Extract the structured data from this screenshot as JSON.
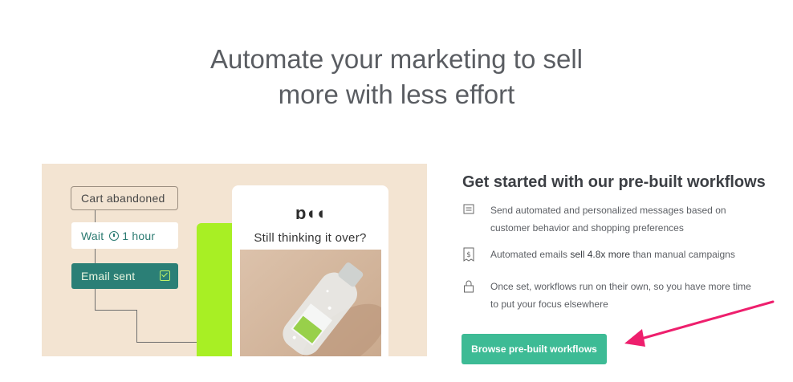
{
  "hero": {
    "line1": "Automate your marketing to sell",
    "line2": "more with less effort"
  },
  "illustration": {
    "cart_chip": "Cart abandoned",
    "wait_label": "Wait",
    "wait_value": "1 hour",
    "email_chip": "Email sent",
    "card_logo": "ɒ◖◖",
    "card_title": "Still thinking it over?"
  },
  "workflows": {
    "title": "Get started with our pre-built workflows",
    "features": [
      {
        "icon": "document-icon",
        "text": "Send automated and personalized messages based on customer behavior and shopping preferences"
      },
      {
        "icon": "dollar-receipt-icon",
        "pre": "Automated emails ",
        "highlight": "sell 4.8x more",
        "post": " than manual campaigns"
      },
      {
        "icon": "lock-icon",
        "text": "Once set, workflows run on their own, so you have more time to put your focus elsewhere"
      }
    ],
    "button_label": "Browse pre-built workflows"
  },
  "colors": {
    "button": "#3dbb95",
    "arrow": "#ee1f6d",
    "lime": "#a8ef24",
    "teal": "#2b7f76",
    "panel": "#f3e4d2"
  }
}
